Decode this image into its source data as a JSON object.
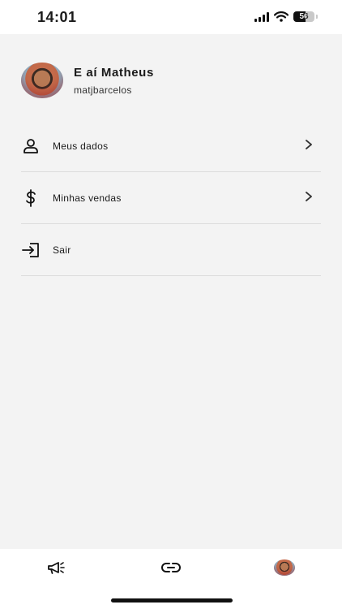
{
  "status_bar": {
    "time": "14:01",
    "battery_level": "56",
    "icons": [
      "cellular-signal-icon",
      "wifi-icon",
      "battery-icon"
    ]
  },
  "profile": {
    "greeting": "E aí  Matheus",
    "username": "matjbarcelos"
  },
  "menu": {
    "items": [
      {
        "label": "Meus dados",
        "icon": "person-icon",
        "has_chevron": true
      },
      {
        "label": "Minhas vendas",
        "icon": "dollar-icon",
        "has_chevron": true
      },
      {
        "label": "Sair",
        "icon": "logout-icon",
        "has_chevron": false
      }
    ]
  },
  "tab_bar": {
    "tabs": [
      {
        "icon": "megaphone-icon"
      },
      {
        "icon": "link-icon"
      },
      {
        "icon": "profile-avatar"
      }
    ]
  },
  "colors": {
    "background": "#f3f3f3",
    "surface": "#ffffff",
    "text": "#1a1a1a",
    "divider": "#dcdcdc"
  }
}
